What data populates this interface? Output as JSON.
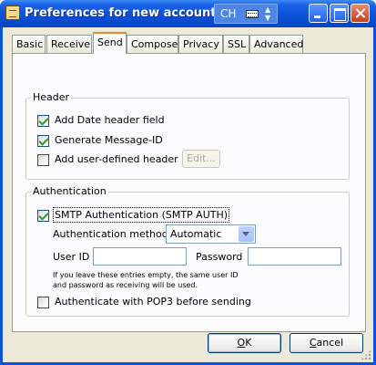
{
  "window": {
    "title": "Preferences for new account",
    "ime": {
      "mode": "CH"
    }
  },
  "tabs": [
    {
      "label": "Basic"
    },
    {
      "label": "Receive"
    },
    {
      "label": "Send",
      "active": true
    },
    {
      "label": "Compose"
    },
    {
      "label": "Privacy"
    },
    {
      "label": "SSL"
    },
    {
      "label": "Advanced"
    }
  ],
  "header_group": {
    "title": "Header",
    "add_date": {
      "label": "Add Date header field",
      "checked": true
    },
    "generate_message_id": {
      "label": "Generate Message-ID",
      "checked": true
    },
    "user_defined": {
      "label": "Add user-defined header",
      "checked": false
    },
    "edit_button": "Edit..."
  },
  "auth_group": {
    "title": "Authentication",
    "smtp_auth": {
      "label": "SMTP Authentication (SMTP AUTH)",
      "checked": true
    },
    "method_label": "Authentication method",
    "method_value": "Automatic",
    "userid_label": "User ID",
    "userid_value": "",
    "password_label": "Password",
    "password_value": "",
    "hint": "If you leave these entries empty, the same user ID and password as receiving will be used.",
    "pop_before_smtp": {
      "label": "Authenticate with POP3 before sending",
      "checked": false
    }
  },
  "buttons": {
    "ok": {
      "mnemonic": "O",
      "rest": "K"
    },
    "cancel": {
      "mnemonic": "C",
      "rest": "ancel"
    }
  },
  "colors": {
    "titlebar": "#0a50d6",
    "dialog_bg": "#ece9d8",
    "tab_highlight": "#e68b2c",
    "checkmark": "#21a121"
  }
}
